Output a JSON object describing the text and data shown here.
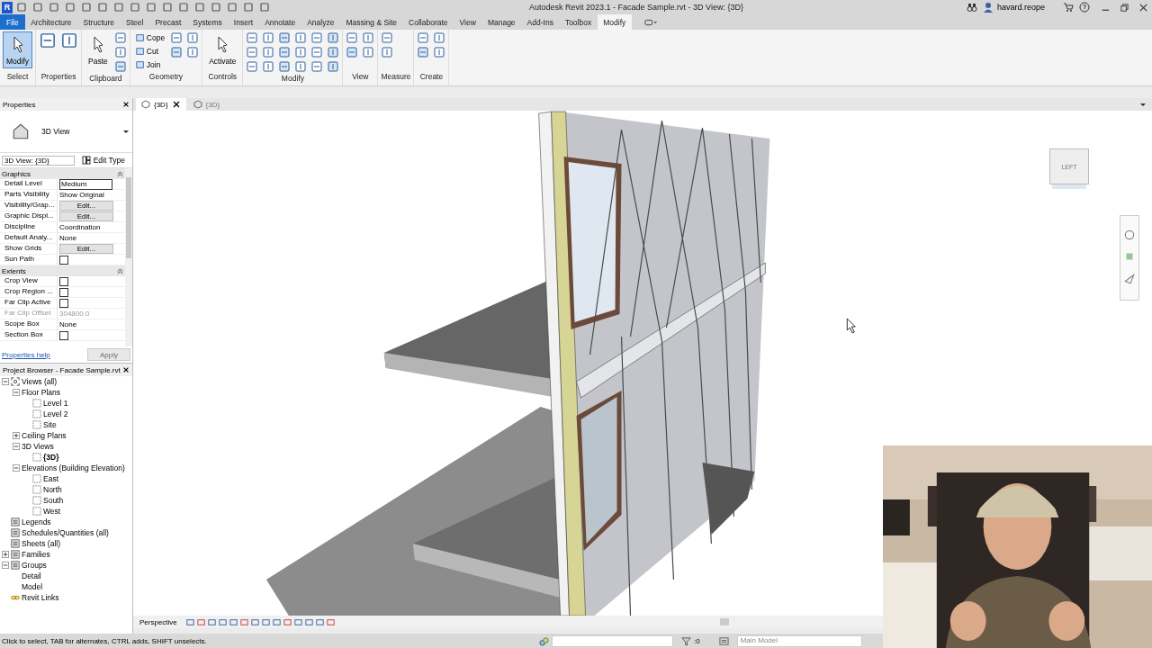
{
  "window": {
    "logo": "R",
    "title": "Autodesk Revit 2023.1 - Facade Sample.rvt - 3D View: {3D}",
    "user": "havard.reope"
  },
  "ribbon_tabs": [
    {
      "label": "File",
      "selected": false,
      "kind": "file"
    },
    {
      "label": "Architecture",
      "selected": false,
      "kind": "tab"
    },
    {
      "label": "Structure",
      "selected": false,
      "kind": "tab"
    },
    {
      "label": "Steel",
      "selected": false,
      "kind": "tab"
    },
    {
      "label": "Precast",
      "selected": false,
      "kind": "tab"
    },
    {
      "label": "Systems",
      "selected": false,
      "kind": "tab"
    },
    {
      "label": "Insert",
      "selected": false,
      "kind": "tab"
    },
    {
      "label": "Annotate",
      "selected": false,
      "kind": "tab"
    },
    {
      "label": "Analyze",
      "selected": false,
      "kind": "tab"
    },
    {
      "label": "Massing & Site",
      "selected": false,
      "kind": "tab"
    },
    {
      "label": "Collaborate",
      "selected": false,
      "kind": "tab"
    },
    {
      "label": "View",
      "selected": false,
      "kind": "tab"
    },
    {
      "label": "Manage",
      "selected": false,
      "kind": "tab"
    },
    {
      "label": "Add-Ins",
      "selected": false,
      "kind": "tab"
    },
    {
      "label": "Toolbox",
      "selected": false,
      "kind": "tab"
    },
    {
      "label": "Modify",
      "selected": true,
      "kind": "tab"
    }
  ],
  "ribbon_panels": [
    {
      "label": "Select",
      "tools": [
        {
          "label": "Modify",
          "kind": "large",
          "selected": true
        }
      ]
    },
    {
      "label": "Properties"
    },
    {
      "label": "Clipboard",
      "tools": [
        {
          "label": "Paste",
          "kind": "large",
          "selected": false
        }
      ]
    },
    {
      "label": "Geometry",
      "tools": [
        {
          "label": "Cope",
          "kind": "small",
          "selected": false
        },
        {
          "label": "Cut",
          "kind": "small",
          "selected": false
        },
        {
          "label": "Join",
          "kind": "small",
          "selected": false
        }
      ]
    },
    {
      "label": "Controls",
      "tools": [
        {
          "label": "Activate",
          "kind": "large",
          "selected": false
        }
      ]
    },
    {
      "label": "Modify"
    },
    {
      "label": "View"
    },
    {
      "label": "Measure"
    },
    {
      "label": "Create"
    }
  ],
  "properties": {
    "title": "Properties",
    "type_name": "3D View",
    "instance": "3D View: {3D}",
    "edit_type": "Edit Type",
    "groups": [
      {
        "label": "Graphics",
        "expanded": true,
        "rows": [
          {
            "name": "Detail Level",
            "kind": "field",
            "value": "Medium",
            "disabled": false
          },
          {
            "name": "Parts Visibility",
            "kind": "text",
            "value": "Show Original",
            "disabled": false
          },
          {
            "name": "Visibility/Grap...",
            "kind": "button",
            "value": "Edit...",
            "disabled": false
          },
          {
            "name": "Graphic Displ...",
            "kind": "button",
            "value": "Edit...",
            "disabled": false
          },
          {
            "name": "Discipline",
            "kind": "text",
            "value": "Coordination",
            "disabled": false
          },
          {
            "name": "Default Analy...",
            "kind": "text",
            "value": "None",
            "disabled": false
          },
          {
            "name": "Show Grids",
            "kind": "button",
            "value": "Edit...",
            "disabled": false
          },
          {
            "name": "Sun Path",
            "kind": "checkbox",
            "checked": false,
            "disabled": false
          }
        ]
      },
      {
        "label": "Extents",
        "expanded": true,
        "rows": [
          {
            "name": "Crop View",
            "kind": "checkbox",
            "checked": false,
            "disabled": false
          },
          {
            "name": "Crop Region ...",
            "kind": "checkbox",
            "checked": false,
            "disabled": false
          },
          {
            "name": "Far Clip Active",
            "kind": "checkbox",
            "checked": false,
            "disabled": false
          },
          {
            "name": "Far Clip Offset",
            "kind": "text",
            "value": "304800.0",
            "disabled": true
          },
          {
            "name": "Scope Box",
            "kind": "text",
            "value": "None",
            "disabled": false
          },
          {
            "name": "Section Box",
            "kind": "checkbox",
            "checked": false,
            "disabled": false
          }
        ]
      }
    ],
    "help_link": "Properties help",
    "apply": {
      "label": "Apply",
      "disabled": true
    }
  },
  "project_browser": {
    "title": "Project Browser - Facade Sample.rvt",
    "tree": [
      {
        "label": "Views (all)",
        "kind": "root",
        "expanded": true,
        "children": [
          {
            "label": "Floor Plans",
            "expanded": true,
            "children": [
              {
                "label": "Level 1",
                "kind": "view",
                "active": false
              },
              {
                "label": "Level 2",
                "kind": "view",
                "active": false
              },
              {
                "label": "Site",
                "kind": "view",
                "active": false
              }
            ]
          },
          {
            "label": "Ceiling Plans",
            "expanded": false
          },
          {
            "label": "3D Views",
            "expanded": true,
            "children": [
              {
                "label": "{3D}",
                "kind": "view",
                "active": true
              }
            ]
          },
          {
            "label": "Elevations (Building Elevation)",
            "expanded": true,
            "children": [
              {
                "label": "East",
                "kind": "view",
                "active": false
              },
              {
                "label": "North",
                "kind": "view",
                "active": false
              },
              {
                "label": "South",
                "kind": "view",
                "active": false
              },
              {
                "label": "West",
                "kind": "view",
                "active": false
              }
            ]
          }
        ]
      },
      {
        "label": "Legends",
        "kind": "category"
      },
      {
        "label": "Schedules/Quantities (all)",
        "kind": "category"
      },
      {
        "label": "Sheets (all)",
        "kind": "category"
      },
      {
        "label": "Families",
        "kind": "category",
        "expanded": false
      },
      {
        "label": "Groups",
        "kind": "category",
        "expanded": true,
        "children": [
          {
            "label": "Detail"
          },
          {
            "label": "Model"
          }
        ]
      },
      {
        "label": "Revit Links",
        "kind": "link"
      }
    ]
  },
  "view_tabs": [
    {
      "label": "{3D}",
      "selected": true
    },
    {
      "label": "{3D}",
      "selected": false
    }
  ],
  "view_cube": "LEFT",
  "view_control": {
    "mode": "Perspective"
  },
  "status_bar": {
    "message": "Click to select, TAB for alternates, CTRL adds, SHIFT unselects.",
    "filter_count": ":0",
    "model": "Main Model"
  }
}
